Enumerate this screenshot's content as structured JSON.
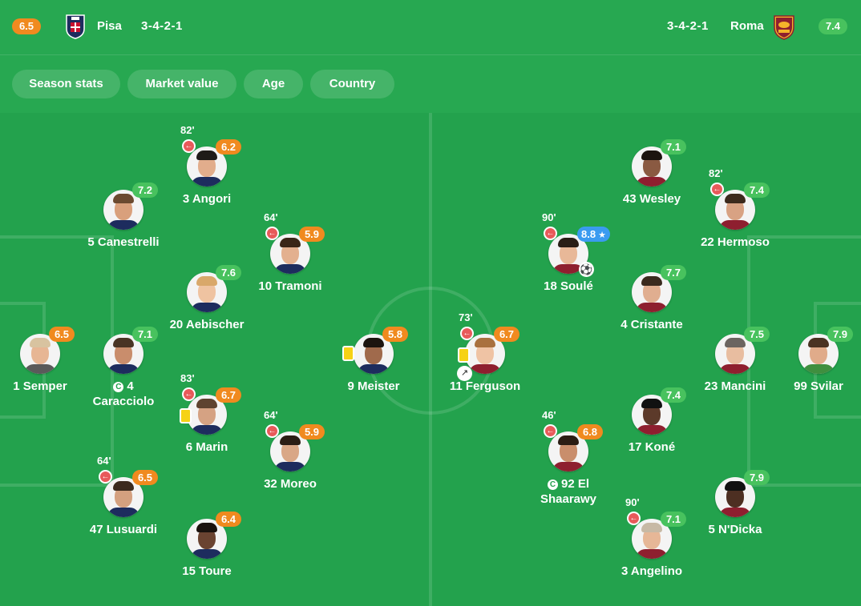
{
  "home": {
    "rating": "6.5",
    "name": "Pisa",
    "formation": "3-4-2-1",
    "rating_color": "#f08a1f"
  },
  "away": {
    "rating": "7.4",
    "name": "Roma",
    "formation": "3-4-2-1",
    "rating_color": "#48c25e"
  },
  "tabs": [
    {
      "label": "Season stats"
    },
    {
      "label": "Market value"
    },
    {
      "label": "Age"
    },
    {
      "label": "Country"
    }
  ],
  "icons": {
    "home_crest": "pisa-crest-icon",
    "away_crest": "roma-crest-icon",
    "sub": "substitution-out-icon",
    "card": "yellow-card-icon",
    "captain": "captain-icon",
    "goal": "goal-ball-icon",
    "assist": "assist-boot-icon",
    "star": "star-icon"
  },
  "captain_letter": "C",
  "players": [
    {
      "name": "1 Semper",
      "rating": "6.5"
    },
    {
      "name": "5 Canestrelli",
      "rating": "7.2"
    },
    {
      "name": "4",
      "name2": "Caracciolo",
      "rating": "7.1"
    },
    {
      "name": "47 Lusuardi",
      "rating": "6.5",
      "sub": "64'"
    },
    {
      "name": "3 Angori",
      "rating": "6.2",
      "sub": "82'"
    },
    {
      "name": "20 Aebischer",
      "rating": "7.6"
    },
    {
      "name": "6 Marin",
      "rating": "6.7",
      "sub": "83'"
    },
    {
      "name": "15 Toure",
      "rating": "6.4"
    },
    {
      "name": "10 Tramoni",
      "rating": "5.9",
      "sub": "64'"
    },
    {
      "name": "32 Moreo",
      "rating": "5.9",
      "sub": "64'"
    },
    {
      "name": "9 Meister",
      "rating": "5.8"
    },
    {
      "name": "11 Ferguson",
      "rating": "6.7",
      "sub": "73'"
    },
    {
      "name": "18 Soulé",
      "rating": "8.8",
      "sub": "90'"
    },
    {
      "name": "92 El",
      "name2": "Shaarawy",
      "rating": "6.8",
      "sub": "46'"
    },
    {
      "name": "43 Wesley",
      "rating": "7.1"
    },
    {
      "name": "4 Cristante",
      "rating": "7.7"
    },
    {
      "name": "17 Koné",
      "rating": "7.4"
    },
    {
      "name": "3 Angelino",
      "rating": "7.1",
      "sub": "90'"
    },
    {
      "name": "22 Hermoso",
      "rating": "7.4",
      "sub": "82'"
    },
    {
      "name": "23 Mancini",
      "rating": "7.5"
    },
    {
      "name": "5 N'Dicka",
      "rating": "7.9"
    },
    {
      "name": "99 Svilar",
      "rating": "7.9"
    }
  ]
}
